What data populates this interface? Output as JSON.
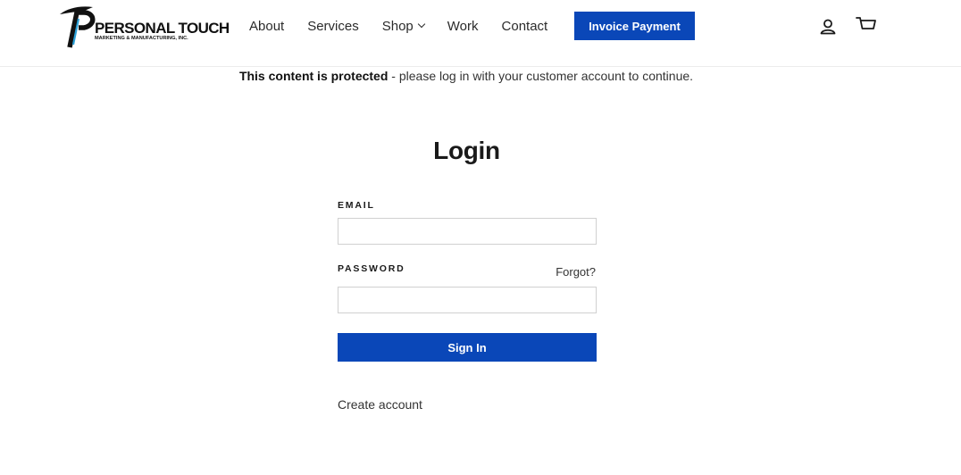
{
  "brand": {
    "name": "PERSONAL TOUCH",
    "tagline": "MARKETING & MANUFACTURING, INC.",
    "accent_color": "#0a47b8",
    "logo_blue": "#2a9fd6"
  },
  "nav": {
    "items": [
      {
        "label": "About"
      },
      {
        "label": "Services"
      },
      {
        "label": "Shop",
        "has_dropdown": true
      },
      {
        "label": "Work"
      },
      {
        "label": "Contact"
      }
    ],
    "invoice_button": "Invoice Payment"
  },
  "header_icons": [
    "account-icon",
    "cart-icon"
  ],
  "notice": {
    "bold": "This content is protected",
    "rest": " - please log in with your customer account to continue."
  },
  "login": {
    "title": "Login",
    "email_label": "EMAIL",
    "email_value": "",
    "password_label": "PASSWORD",
    "password_value": "",
    "forgot_label": "Forgot?",
    "submit_label": "Sign In",
    "create_account_label": "Create account"
  }
}
